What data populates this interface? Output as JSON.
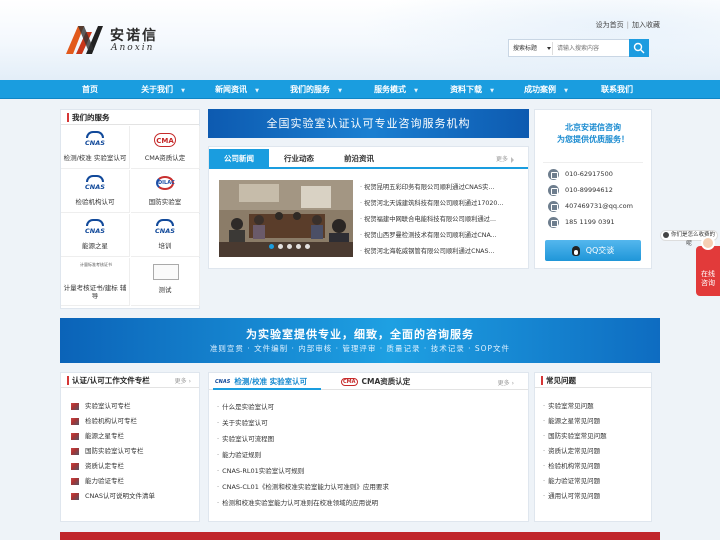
{
  "header": {
    "logo_cn": "安诺信",
    "logo_en": "Anoxin",
    "links": [
      "设为首页",
      "加入收藏"
    ],
    "link_sep": "|",
    "search": {
      "select_label": "搜索标题",
      "placeholder": "请输入搜索内容"
    }
  },
  "nav": [
    {
      "label": "首页",
      "dropdown": false
    },
    {
      "label": "关于我们",
      "dropdown": true
    },
    {
      "label": "新闻资讯",
      "dropdown": true
    },
    {
      "label": "我们的服务",
      "dropdown": true
    },
    {
      "label": "服务模式",
      "dropdown": true
    },
    {
      "label": "资料下载",
      "dropdown": true
    },
    {
      "label": "成功案例",
      "dropdown": true
    },
    {
      "label": "联系我们",
      "dropdown": false
    }
  ],
  "services": {
    "title": "我们的服务",
    "items": [
      {
        "label": "检测/校准 实验室认可",
        "icon": "cnas-icon",
        "icon_text": "CNAS"
      },
      {
        "label": "CMA资质认定",
        "icon": "cma-icon",
        "icon_text": "CMA"
      },
      {
        "label": "检验机构认可",
        "icon": "cnas-icon",
        "icon_text": "CNAS"
      },
      {
        "label": "国防实验室",
        "icon": "dilac-icon",
        "icon_text": "DILAC"
      },
      {
        "label": "能源之星",
        "icon": "cnas-icon",
        "icon_text": "CNAS"
      },
      {
        "label": "培训",
        "icon": "cnas-icon",
        "icon_text": "CNAS"
      },
      {
        "label": "计量考核证书/建标 辅导",
        "icon": "certificate-icon",
        "icon_text": "计量标准考核证书"
      },
      {
        "label": "测试",
        "icon": "broken-image-icon",
        "icon_text": ""
      }
    ]
  },
  "banner1": "全国实验室认证认可专业咨询服务机构",
  "news": {
    "tabs": [
      "公司新闻",
      "行业动态",
      "前沿资讯"
    ],
    "active_tab": 0,
    "more": "更多",
    "items": [
      "祝贺昆明五彩印务有限公司顺利通过CNAS实...",
      "祝贺河北天诚建筑科技有限公司顺利通过17020...",
      "祝贺福建中网联合电能科技有限公司顺利通过...",
      "祝贺山西罗曼检测技术有限公司顺利通过CNA...",
      "祝贺河北海乾威钢管有限公司顺利通过CNAS..."
    ],
    "slides": 5,
    "active_slide": 0
  },
  "contact": {
    "slogan1": "北京安诺信咨询",
    "slogan2": "为您提供优质服务！",
    "rows": [
      {
        "icon": "phone-icon",
        "text": "010-62917500"
      },
      {
        "icon": "phone-icon",
        "text": "010-89994612"
      },
      {
        "icon": "email-icon",
        "text": "407469731@qq.com"
      },
      {
        "icon": "mobile-icon",
        "text": "185 1199 0391"
      }
    ],
    "qq_label": "QQ交谈"
  },
  "banner2": {
    "title": "为实验室提供专业，细致，全面的咨询服务",
    "subtitle": "准则宣贯 · 文件编制 · 内部审核 · 管理评审 · 质量记录 · 技术记录 · SOP文件"
  },
  "docs": {
    "title": "认证/认可工作文件专栏",
    "more": "更多",
    "items": [
      "实验室认可专栏",
      "检验机构认可专栏",
      "能源之星专栏",
      "国防实验室认可专栏",
      "资质认定专栏",
      "能力验证专栏",
      "CNAS认可说明文件清单"
    ]
  },
  "center": {
    "tabs": [
      {
        "label": "检测/校准 实验室认可",
        "logo": "CNAS"
      },
      {
        "label": "CMA资质认定",
        "logo": "CMA"
      }
    ],
    "active_tab": 0,
    "more": "更多",
    "items": [
      "什么是实验室认可",
      "关于实验室认可",
      "实验室认可流程图",
      "能力验证规则",
      "CNAS-RL01实验室认可规则",
      "CNAS-CL01《检测和校准实验室能力认可准则》应用要求",
      "检测和校准实验室能力认可准则在校准领域的应用说明"
    ]
  },
  "faq": {
    "title": "常见问题",
    "items": [
      "实验室常见问题",
      "能源之星常见问题",
      "国防实验室常见问题",
      "资质认定常见问题",
      "检验机构常见问题",
      "能力验证常见问题",
      "通用认可常见问题"
    ]
  },
  "floating": {
    "bubble": "你们是怎么收费的呢",
    "chat_label": [
      "在线",
      "咨询"
    ]
  },
  "colors": {
    "accent": "#1a9ddf",
    "title_bar": "#d63636",
    "footer_strip": "#c0262b"
  }
}
